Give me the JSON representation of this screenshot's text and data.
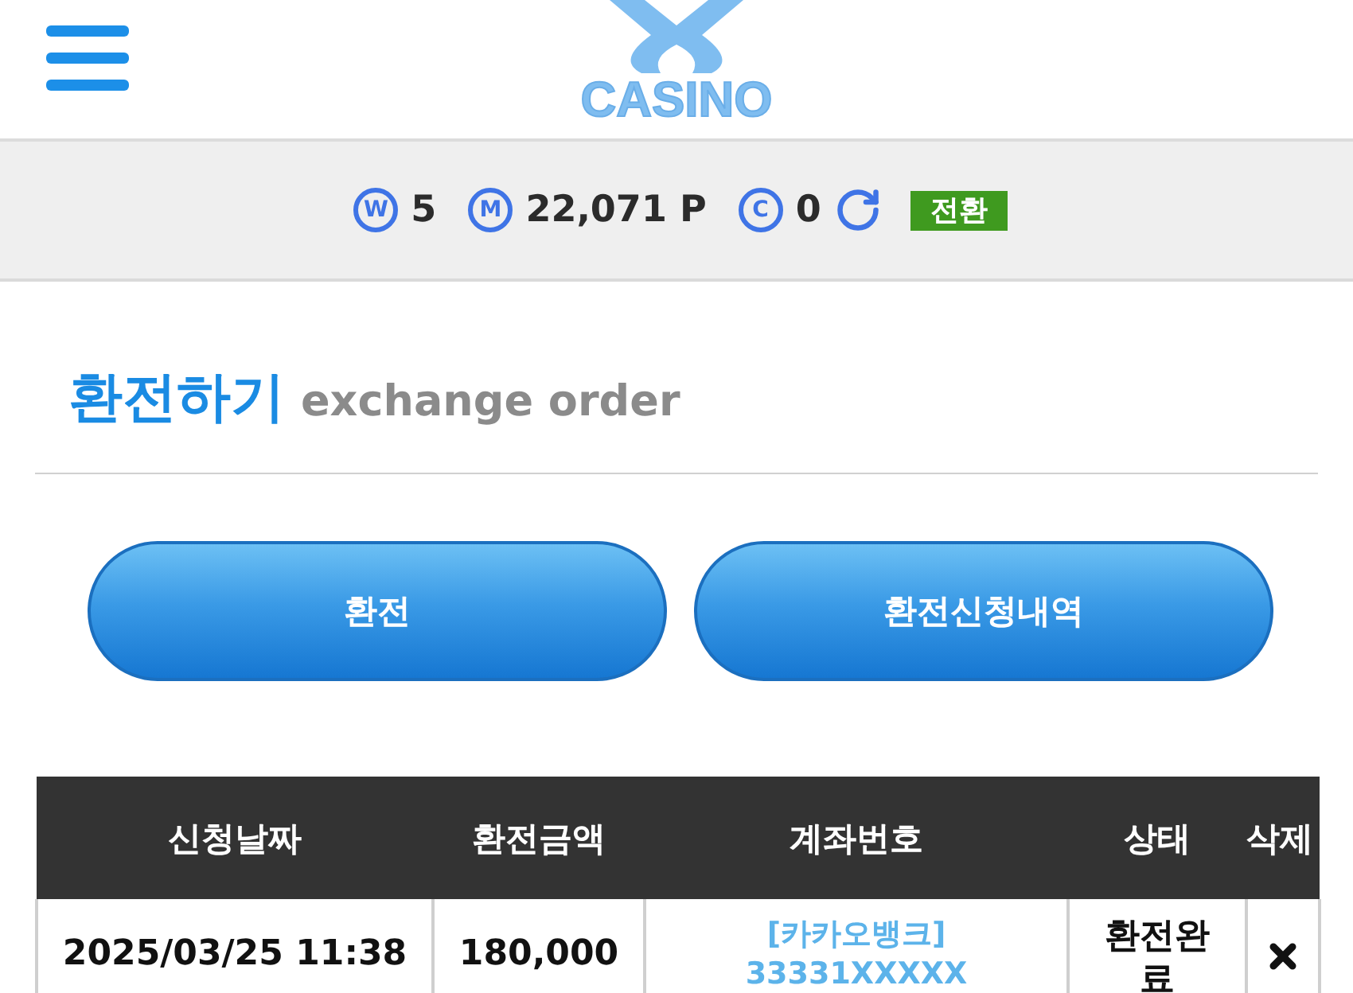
{
  "header": {
    "logo_text": "CASINO"
  },
  "balance_bar": {
    "items": [
      {
        "symbol": "W",
        "value": "5"
      },
      {
        "symbol": "M",
        "value": "22,071 P"
      },
      {
        "symbol": "C",
        "value": "0"
      }
    ],
    "convert_button": "전환"
  },
  "section": {
    "title": "환전하기",
    "subtitle": "exchange order"
  },
  "buttons": [
    {
      "label": "환전"
    },
    {
      "label": "환전신청내역"
    }
  ],
  "table": {
    "columns": [
      "신청날짜",
      "환전금액",
      "계좌번호",
      "상태",
      "삭제"
    ],
    "rows": [
      {
        "date": "2025/03/25 11:38",
        "amount": "180,000",
        "bank": "[카카오뱅크]",
        "account": "33331XXXXX",
        "status": "환전완료"
      }
    ]
  }
}
